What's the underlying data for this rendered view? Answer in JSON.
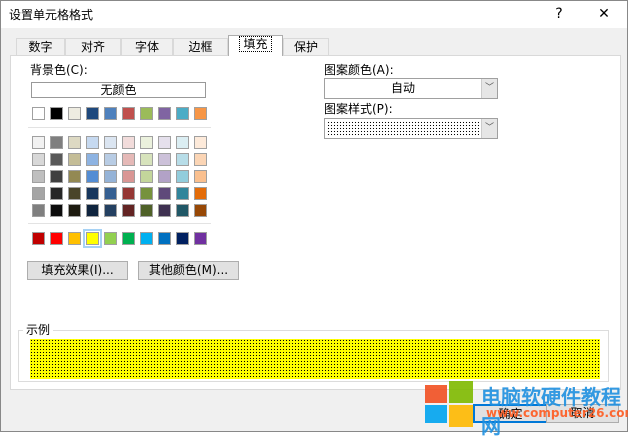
{
  "window": {
    "title": "设置单元格格式",
    "help": "?",
    "close": "✕"
  },
  "tabs": [
    "数字",
    "对齐",
    "字体",
    "边框",
    "填充",
    "保护"
  ],
  "active_tab": "填充",
  "background": {
    "label": "背景色(C):",
    "no_color": "无颜色",
    "theme_top": [
      "#ffffff",
      "#000000",
      "#eeece1",
      "#1f497d",
      "#4f81bd",
      "#c0504d",
      "#9bbb59",
      "#8064a2",
      "#4bacc6",
      "#f79646"
    ],
    "theme_shades": [
      [
        "#f2f2f2",
        "#7f7f7f",
        "#ddd9c3",
        "#c6d9f0",
        "#dbe5f1",
        "#f2dcdb",
        "#ebf1dd",
        "#e5e0ec",
        "#dbeef3",
        "#fdeada"
      ],
      [
        "#d8d8d8",
        "#595959",
        "#c4bd97",
        "#8db3e2",
        "#b8cce4",
        "#e5b9b7",
        "#d7e3bc",
        "#ccc1d9",
        "#b7dde8",
        "#fbd5b5"
      ],
      [
        "#bfbfbf",
        "#3f3f3f",
        "#938953",
        "#548dd4",
        "#95b3d7",
        "#d99694",
        "#c3d69b",
        "#b2a2c7",
        "#92cddc",
        "#fac08f"
      ],
      [
        "#a5a5a5",
        "#262626",
        "#494429",
        "#17365d",
        "#366092",
        "#953734",
        "#76923c",
        "#5f497a",
        "#31859b",
        "#e36c09"
      ],
      [
        "#7f7f7f",
        "#0c0c0c",
        "#1d1b10",
        "#0f243e",
        "#244061",
        "#632423",
        "#4f6128",
        "#3f3151",
        "#205867",
        "#974806"
      ]
    ],
    "standard": [
      "#c00000",
      "#ff0000",
      "#ffc000",
      "#ffff00",
      "#92d050",
      "#00b050",
      "#00b0f0",
      "#0070c0",
      "#002060",
      "#7030a0"
    ],
    "selected": "#ffff00",
    "fill_effects": "填充效果(I)...",
    "more_colors": "其他颜色(M)..."
  },
  "pattern": {
    "color_label": "图案颜色(A):",
    "color_value": "自动",
    "style_label": "图案样式(P):"
  },
  "sample": {
    "label": "示例",
    "color": "#ffff00"
  },
  "buttons": {
    "ok": "确定",
    "cancel": "取消"
  },
  "watermark": {
    "text": "电脑软硬件教程网",
    "url": "www.computer26.com"
  }
}
